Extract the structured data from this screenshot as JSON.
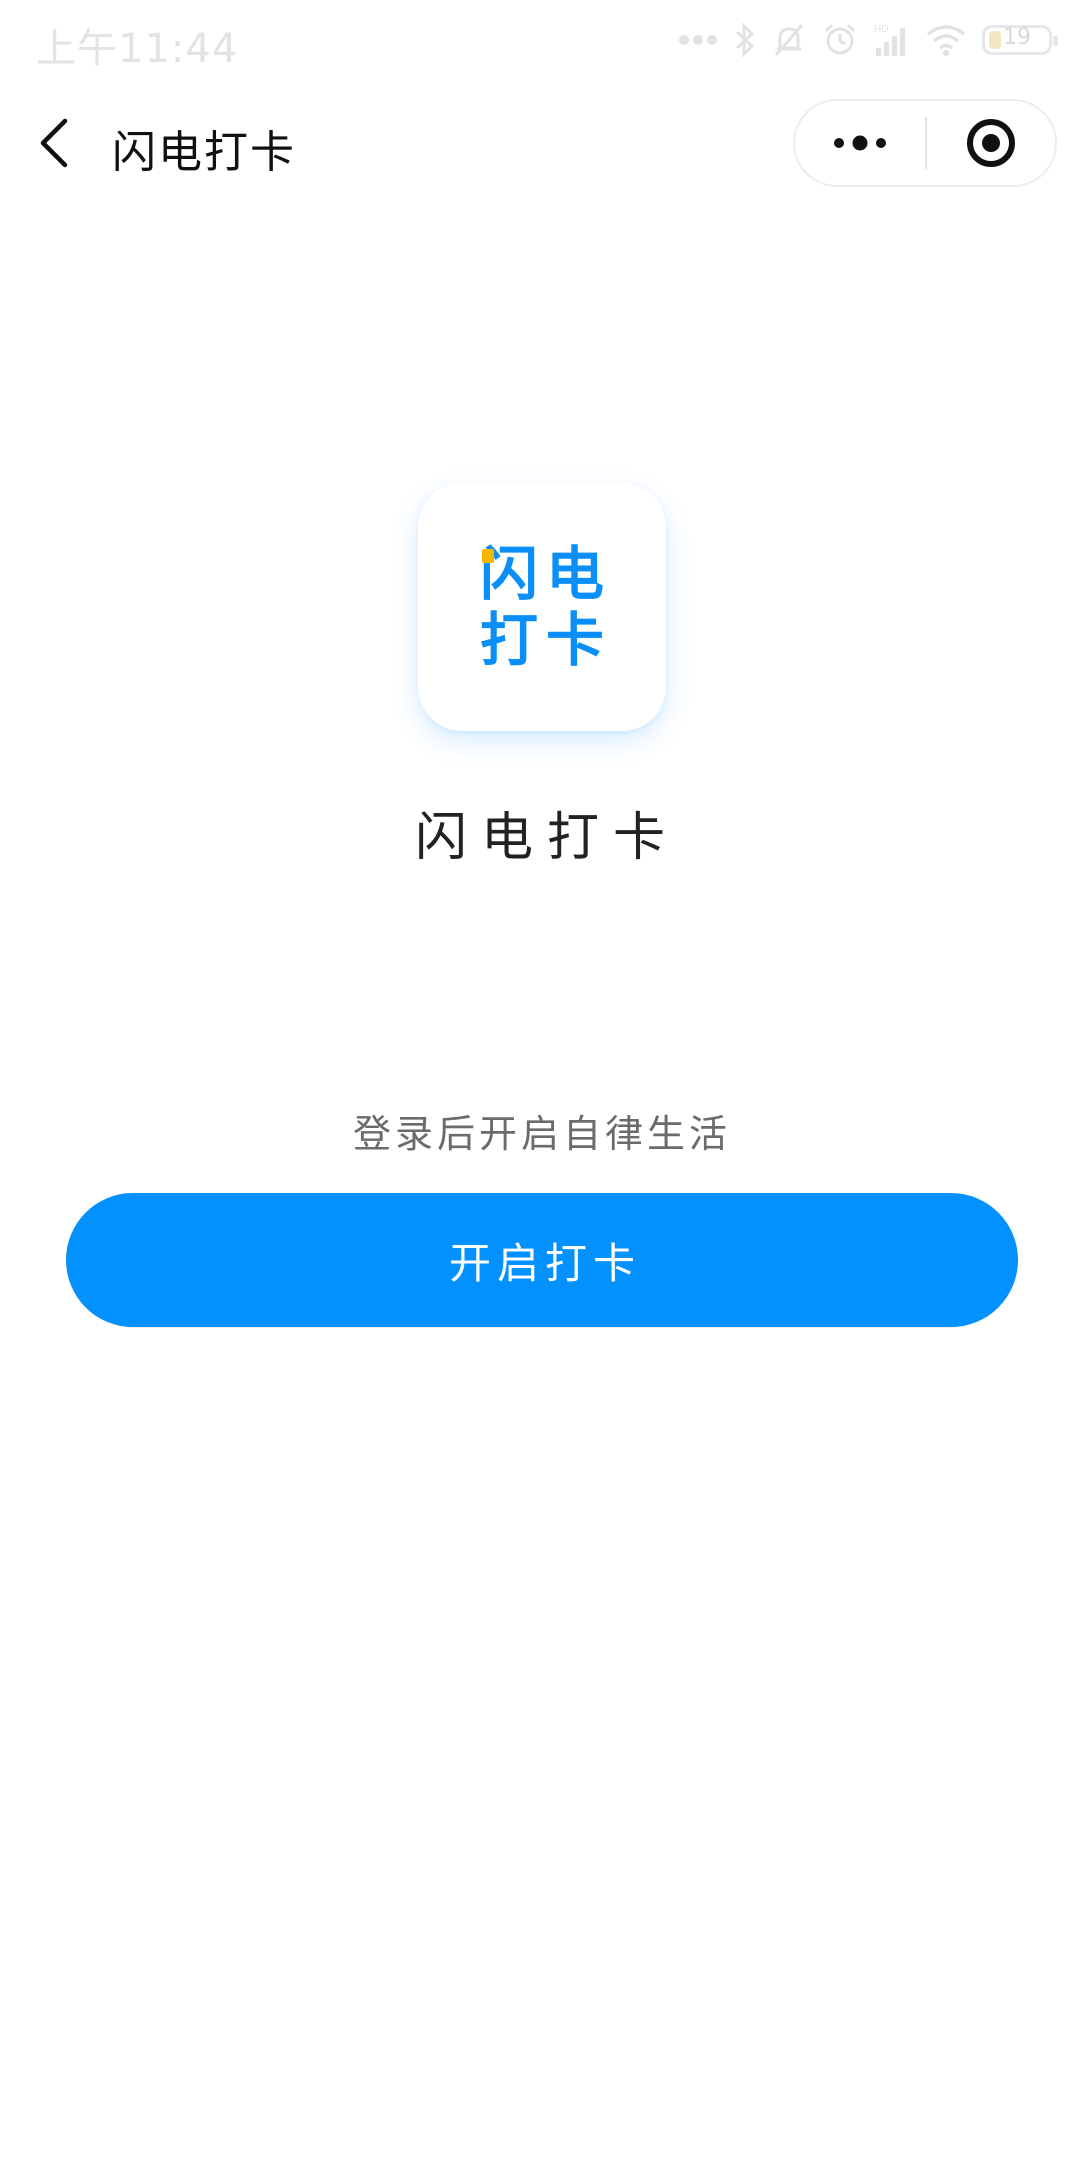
{
  "status_bar": {
    "time": "上午11:44",
    "battery_level": "19",
    "icons": [
      "more-dots-icon",
      "bluetooth-icon",
      "mute-bell-icon",
      "alarm-icon",
      "hd-signal-icon",
      "wifi-icon",
      "battery-icon"
    ]
  },
  "nav": {
    "back_icon": "chevron-left-icon",
    "title": "闪电打卡",
    "capsule": {
      "more_icon": "more-dots-icon",
      "close_icon": "target-circle-icon"
    }
  },
  "logo": {
    "glyphs": [
      "闪",
      "电",
      "打",
      "卡"
    ],
    "accent": "#F7B500",
    "brand": "#0A8EF7"
  },
  "app_name": "闪电打卡",
  "hint": "登录后开启自律生活",
  "primary_button": {
    "label": "开启打卡",
    "color": "#0291FF"
  }
}
